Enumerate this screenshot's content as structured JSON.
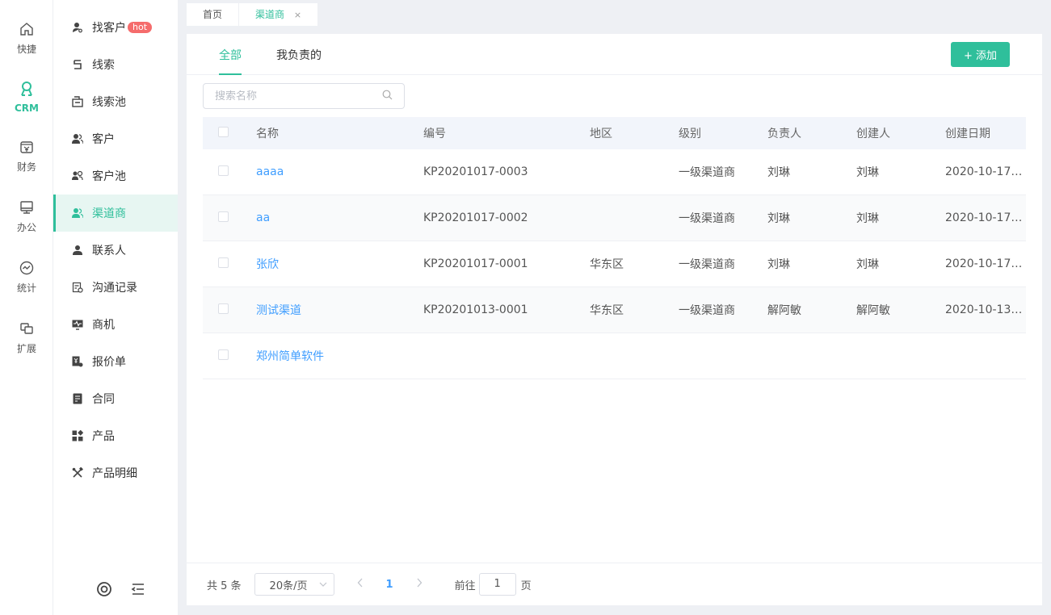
{
  "rail": [
    {
      "label": "快捷",
      "icon": "home-icon"
    },
    {
      "label": "CRM",
      "icon": "crm-icon"
    },
    {
      "label": "财务",
      "icon": "finance-icon"
    },
    {
      "label": "办公",
      "icon": "monitor-icon"
    },
    {
      "label": "统计",
      "icon": "stats-icon"
    },
    {
      "label": "扩展",
      "icon": "extend-icon"
    }
  ],
  "menu": {
    "items": [
      {
        "label": "找客户",
        "badge": "hot"
      },
      {
        "label": "线索"
      },
      {
        "label": "线索池"
      },
      {
        "label": "客户"
      },
      {
        "label": "客户池"
      },
      {
        "label": "渠道商"
      },
      {
        "label": "联系人"
      },
      {
        "label": "沟通记录"
      },
      {
        "label": "商机"
      },
      {
        "label": "报价单"
      },
      {
        "label": "合同"
      },
      {
        "label": "产品"
      },
      {
        "label": "产品明细"
      }
    ]
  },
  "top_tabs": [
    {
      "label": "首页"
    },
    {
      "label": "渠道商",
      "close": "×"
    }
  ],
  "sub_tabs": [
    "全部",
    "我负责的"
  ],
  "add_button": "+ 添加",
  "search": {
    "placeholder": "搜索名称"
  },
  "table": {
    "headers": [
      "名称",
      "编号",
      "地区",
      "级别",
      "负责人",
      "创建人",
      "创建日期"
    ],
    "rows": [
      [
        "aaaa",
        "KP20201017-0003",
        "",
        "一级渠道商",
        "刘琳",
        "刘琳",
        "2020-10-17…"
      ],
      [
        "aa",
        "KP20201017-0002",
        "",
        "一级渠道商",
        "刘琳",
        "刘琳",
        "2020-10-17…"
      ],
      [
        "张欣",
        "KP20201017-0001",
        "华东区",
        "一级渠道商",
        "刘琳",
        "刘琳",
        "2020-10-17…"
      ],
      [
        "测试渠道",
        "KP20201013-0001",
        "华东区",
        "一级渠道商",
        "解阿敏",
        "解阿敏",
        "2020-10-13…"
      ],
      [
        "郑州简单软件",
        "",
        "",
        "",
        "",
        "",
        ""
      ]
    ]
  },
  "pager": {
    "total": "共 5 条",
    "page_size": "20条/页",
    "current": "1",
    "goto_prefix": "前往",
    "goto_value": "1",
    "goto_suffix": "页"
  },
  "colors": {
    "accent": "#2fbf9b",
    "link": "#409eff",
    "hot": "#f56c6c"
  }
}
